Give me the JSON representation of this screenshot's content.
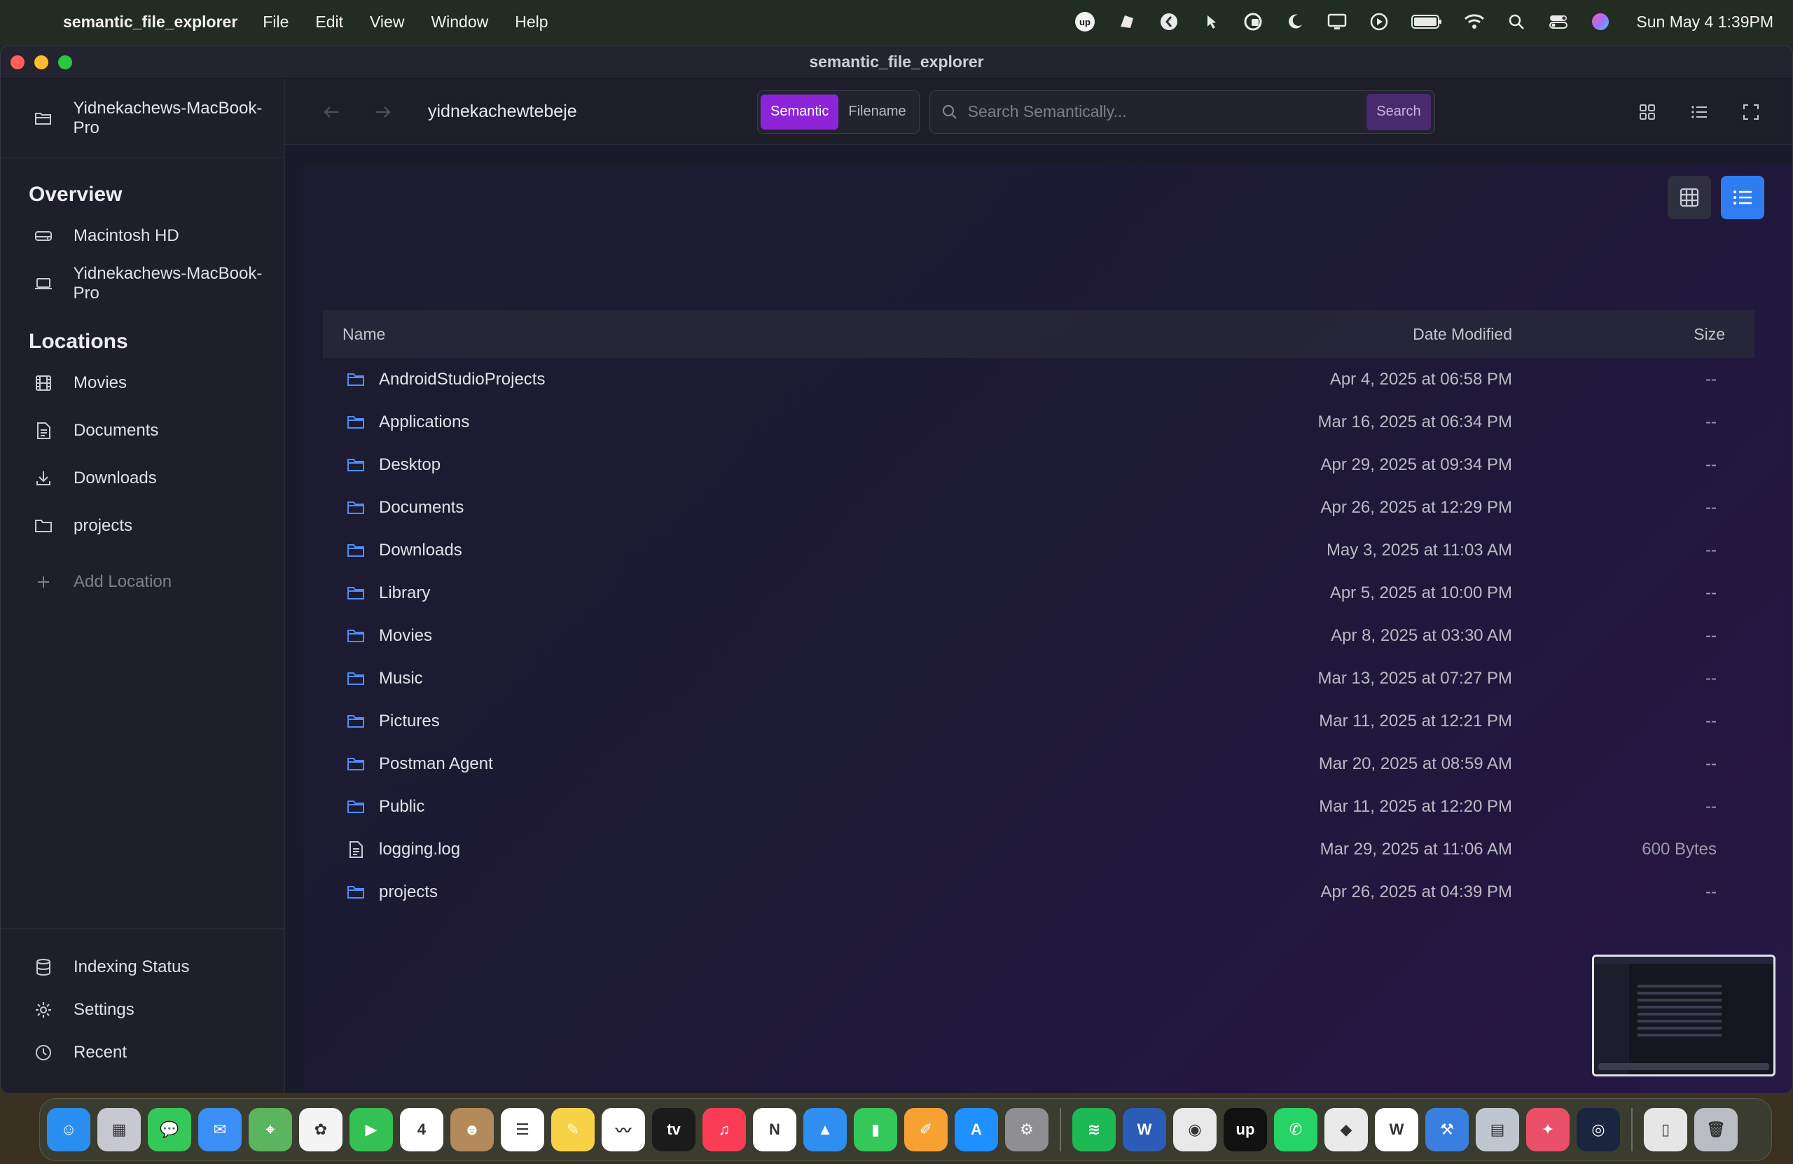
{
  "menubar": {
    "app_name": "semantic_file_explorer",
    "menus": [
      "File",
      "Edit",
      "View",
      "Window",
      "Help"
    ],
    "clock": "Sun May 4  1:39PM",
    "status_icons": [
      "upwork-icon",
      "bear-icon",
      "app-icon",
      "mouse-icon",
      "vpn-icon",
      "moon-icon",
      "display-icon",
      "play-icon",
      "battery-icon",
      "wifi-icon",
      "search-icon",
      "control-center-icon",
      "siri-icon"
    ]
  },
  "window": {
    "title": "semantic_file_explorer"
  },
  "sidebar": {
    "device_top": "Yidnekachews-MacBook-Pro",
    "overview_heading": "Overview",
    "overview_items": [
      {
        "label": "Macintosh HD",
        "icon": "drive-icon"
      },
      {
        "label": "Yidnekachews-MacBook-Pro",
        "icon": "laptop-icon"
      }
    ],
    "locations_heading": "Locations",
    "location_items": [
      {
        "label": "Movies",
        "icon": "film-icon"
      },
      {
        "label": "Documents",
        "icon": "document-icon"
      },
      {
        "label": "Downloads",
        "icon": "download-icon"
      },
      {
        "label": "projects",
        "icon": "folder-icon"
      }
    ],
    "add_location": "Add Location",
    "bottom_items": [
      {
        "label": "Indexing Status",
        "icon": "database-icon"
      },
      {
        "label": "Settings",
        "icon": "gear-icon"
      },
      {
        "label": "Recent",
        "icon": "clock-icon"
      }
    ]
  },
  "toolbar": {
    "breadcrumb": "yidnekachewtebeje",
    "mode_semantic": "Semantic",
    "mode_filename": "Filename",
    "search_placeholder": "Search Semantically...",
    "search_button": "Search"
  },
  "table": {
    "headers": {
      "name": "Name",
      "date": "Date Modified",
      "size": "Size"
    },
    "rows": [
      {
        "name": "AndroidStudioProjects",
        "date": "Apr 4, 2025 at 06:58 PM",
        "size": "--",
        "type": "folder"
      },
      {
        "name": "Applications",
        "date": "Mar 16, 2025 at 06:34 PM",
        "size": "--",
        "type": "folder"
      },
      {
        "name": "Desktop",
        "date": "Apr 29, 2025 at 09:34 PM",
        "size": "--",
        "type": "folder"
      },
      {
        "name": "Documents",
        "date": "Apr 26, 2025 at 12:29 PM",
        "size": "--",
        "type": "folder"
      },
      {
        "name": "Downloads",
        "date": "May 3, 2025 at 11:03 AM",
        "size": "--",
        "type": "folder"
      },
      {
        "name": "Library",
        "date": "Apr 5, 2025 at 10:00 PM",
        "size": "--",
        "type": "folder"
      },
      {
        "name": "Movies",
        "date": "Apr 8, 2025 at 03:30 AM",
        "size": "--",
        "type": "folder"
      },
      {
        "name": "Music",
        "date": "Mar 13, 2025 at 07:27 PM",
        "size": "--",
        "type": "folder"
      },
      {
        "name": "Pictures",
        "date": "Mar 11, 2025 at 12:21 PM",
        "size": "--",
        "type": "folder"
      },
      {
        "name": "Postman Agent",
        "date": "Mar 20, 2025 at 08:59 AM",
        "size": "--",
        "type": "folder"
      },
      {
        "name": "Public",
        "date": "Mar 11, 2025 at 12:20 PM",
        "size": "--",
        "type": "folder"
      },
      {
        "name": "logging.log",
        "date": "Mar 29, 2025 at 11:06 AM",
        "size": "600 Bytes",
        "type": "file"
      },
      {
        "name": "projects",
        "date": "Apr 26, 2025 at 04:39 PM",
        "size": "--",
        "type": "folder"
      }
    ]
  },
  "dock": {
    "apps": [
      {
        "name": "finder",
        "color": "#2a8ef0",
        "glyph": "☺"
      },
      {
        "name": "launchpad",
        "color": "#c8c8d0",
        "glyph": "▦"
      },
      {
        "name": "messages",
        "color": "#34c759",
        "glyph": "💬"
      },
      {
        "name": "mail",
        "color": "#3a8ef5",
        "glyph": "✉"
      },
      {
        "name": "maps",
        "color": "#5ab55e",
        "glyph": "⌖"
      },
      {
        "name": "photos",
        "color": "#f4f4f4",
        "glyph": "✿"
      },
      {
        "name": "facetime",
        "color": "#32c152",
        "glyph": "▶"
      },
      {
        "name": "calendar",
        "color": "#ffffff",
        "glyph": "4"
      },
      {
        "name": "contacts",
        "color": "#b48a5a",
        "glyph": "☻"
      },
      {
        "name": "reminders",
        "color": "#ffffff",
        "glyph": "☰"
      },
      {
        "name": "notes",
        "color": "#f7d247",
        "glyph": "✎"
      },
      {
        "name": "freeform",
        "color": "#ffffff",
        "glyph": "〰"
      },
      {
        "name": "apple-tv",
        "color": "#1b1b1b",
        "glyph": "tv"
      },
      {
        "name": "music",
        "color": "#fa3c55",
        "glyph": "♫"
      },
      {
        "name": "news",
        "color": "#ffffff",
        "glyph": "N"
      },
      {
        "name": "keynote",
        "color": "#2f8ff0",
        "glyph": "▲"
      },
      {
        "name": "numbers",
        "color": "#34c759",
        "glyph": "▮"
      },
      {
        "name": "pages",
        "color": "#f7a133",
        "glyph": "✐"
      },
      {
        "name": "app-store",
        "color": "#1e90ff",
        "glyph": "A"
      },
      {
        "name": "system-settings",
        "color": "#8e8e93",
        "glyph": "⚙"
      },
      {
        "name": "spotify",
        "color": "#1db954",
        "glyph": "≋"
      },
      {
        "name": "word",
        "color": "#2b5cb8",
        "glyph": "W"
      },
      {
        "name": "chrome",
        "color": "#e8e8e8",
        "glyph": "◉"
      },
      {
        "name": "upwork",
        "color": "#111111",
        "glyph": "up"
      },
      {
        "name": "whatsapp",
        "color": "#25d366",
        "glyph": "✆"
      },
      {
        "name": "unity",
        "color": "#eaeaea",
        "glyph": "◆"
      },
      {
        "name": "wps",
        "color": "#ffffff",
        "glyph": "W"
      },
      {
        "name": "xcode",
        "color": "#3a7fe0",
        "glyph": "⚒"
      },
      {
        "name": "preview",
        "color": "#c0c6d0",
        "glyph": "▤"
      },
      {
        "name": "bear",
        "color": "#ea4f68",
        "glyph": "✦"
      },
      {
        "name": "copilot",
        "color": "#1a2540",
        "glyph": "◎"
      },
      {
        "name": "downloads-stack",
        "color": "#e6e6e6",
        "glyph": "▯"
      },
      {
        "name": "trash",
        "color": "#b9bcc2",
        "glyph": "🗑"
      }
    ]
  }
}
